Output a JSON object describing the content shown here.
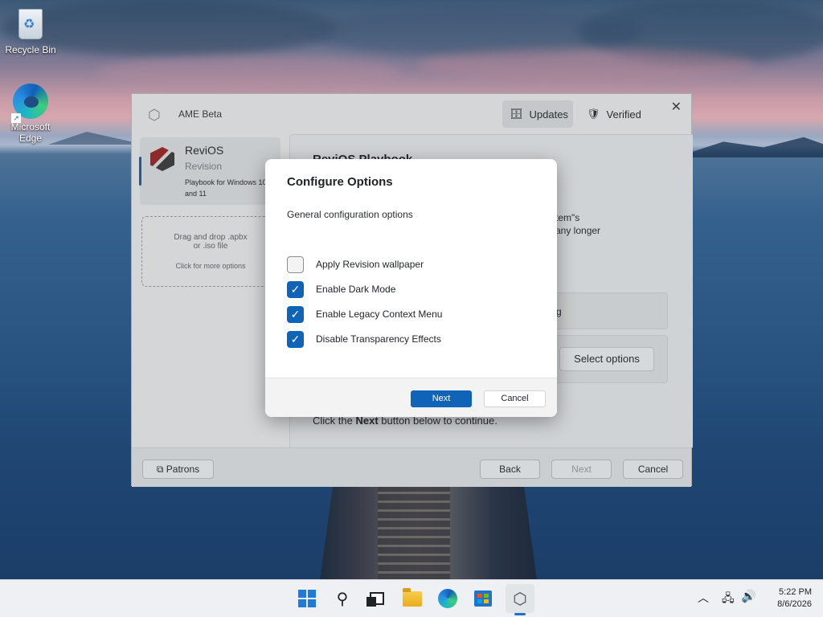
{
  "desktop": {
    "icons": [
      {
        "label": "Recycle Bin"
      },
      {
        "label": "Microsoft Edge"
      }
    ]
  },
  "ame": {
    "title": "AME Beta",
    "updates_label": "Updates",
    "verified_label": "Verified",
    "close_glyph": "✕",
    "playbook": {
      "title": "ReviOS",
      "subtitle": "Revision",
      "description": "Playbook for Windows 10 and 11"
    },
    "drop": {
      "line1": "Drag and drop .apbx",
      "line2": "or .iso file",
      "line3": "Click for more options"
    },
    "content": {
      "heading": "ReviOS Playbook",
      "text1": "tem\"s",
      "text2": "any longer",
      "card1_text": "g",
      "select_label": "Select options",
      "continue_pre": "Click the ",
      "continue_bold": "Next",
      "continue_post": " button below to continue."
    },
    "footer": {
      "patrons": "Patrons",
      "back": "Back",
      "next": "Next",
      "cancel": "Cancel"
    }
  },
  "dialog": {
    "title": "Configure Options",
    "subtitle": "General configuration options",
    "options": [
      {
        "label": "Apply Revision wallpaper",
        "checked": false
      },
      {
        "label": "Enable Dark Mode",
        "checked": true
      },
      {
        "label": "Enable Legacy Context Menu",
        "checked": true
      },
      {
        "label": "Disable Transparency Effects",
        "checked": true
      }
    ],
    "next_label": "Next",
    "cancel_label": "Cancel"
  },
  "taskbar": {
    "time": "5:22 PM",
    "date": "8/6/2026"
  },
  "colors": {
    "accent": "#0f64b8"
  }
}
